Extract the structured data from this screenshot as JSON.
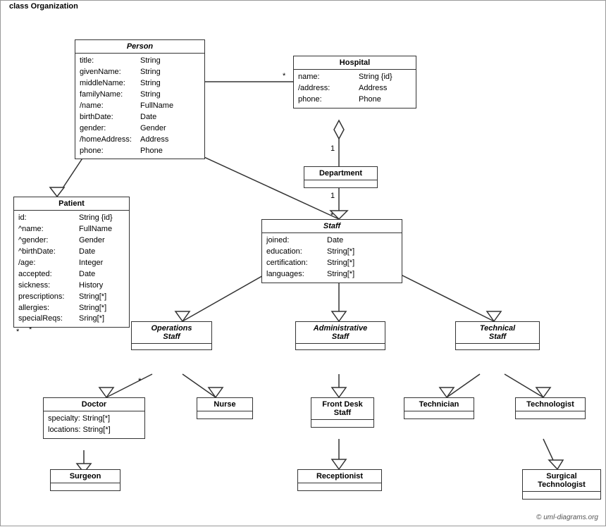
{
  "diagram_title": "class Organization",
  "copyright": "© uml-diagrams.org",
  "classes": {
    "person": {
      "name": "Person",
      "italic": true,
      "attrs": [
        {
          "name": "title:",
          "type": "String"
        },
        {
          "name": "givenName:",
          "type": "String"
        },
        {
          "name": "middleName:",
          "type": "String"
        },
        {
          "name": "familyName:",
          "type": "String"
        },
        {
          "name": "/name:",
          "type": "FullName"
        },
        {
          "name": "birthDate:",
          "type": "Date"
        },
        {
          "name": "gender:",
          "type": "Gender"
        },
        {
          "name": "/homeAddress:",
          "type": "Address"
        },
        {
          "name": "phone:",
          "type": "Phone"
        }
      ]
    },
    "hospital": {
      "name": "Hospital",
      "attrs": [
        {
          "name": "name:",
          "type": "String {id}"
        },
        {
          "name": "/address:",
          "type": "Address"
        },
        {
          "name": "phone:",
          "type": "Phone"
        }
      ]
    },
    "department": {
      "name": "Department",
      "attrs": []
    },
    "patient": {
      "name": "Patient",
      "attrs": [
        {
          "name": "id:",
          "type": "String {id}"
        },
        {
          "name": "^name:",
          "type": "FullName"
        },
        {
          "name": "^gender:",
          "type": "Gender"
        },
        {
          "name": "^birthDate:",
          "type": "Date"
        },
        {
          "name": "/age:",
          "type": "Integer"
        },
        {
          "name": "accepted:",
          "type": "Date"
        },
        {
          "name": "sickness:",
          "type": "History"
        },
        {
          "name": "prescriptions:",
          "type": "String[*]"
        },
        {
          "name": "allergies:",
          "type": "String[*]"
        },
        {
          "name": "specialReqs:",
          "type": "Sring[*]"
        }
      ]
    },
    "staff": {
      "name": "Staff",
      "italic": true,
      "attrs": [
        {
          "name": "joined:",
          "type": "Date"
        },
        {
          "name": "education:",
          "type": "String[*]"
        },
        {
          "name": "certification:",
          "type": "String[*]"
        },
        {
          "name": "languages:",
          "type": "String[*]"
        }
      ]
    },
    "operations_staff": {
      "name": "Operations Staff",
      "italic": true
    },
    "administrative_staff": {
      "name": "Administrative Staff",
      "italic": true
    },
    "technical_staff": {
      "name": "Technical Staff",
      "italic": true
    },
    "doctor": {
      "name": "Doctor",
      "attrs": [
        {
          "name": "specialty:",
          "type": "String[*]"
        },
        {
          "name": "locations:",
          "type": "String[*]"
        }
      ]
    },
    "nurse": {
      "name": "Nurse",
      "attrs": []
    },
    "front_desk_staff": {
      "name": "Front Desk Staff",
      "attrs": []
    },
    "technician": {
      "name": "Technician",
      "attrs": []
    },
    "technologist": {
      "name": "Technologist",
      "attrs": []
    },
    "surgeon": {
      "name": "Surgeon",
      "attrs": []
    },
    "receptionist": {
      "name": "Receptionist",
      "attrs": []
    },
    "surgical_technologist": {
      "name": "Surgical Technologist",
      "attrs": []
    }
  }
}
